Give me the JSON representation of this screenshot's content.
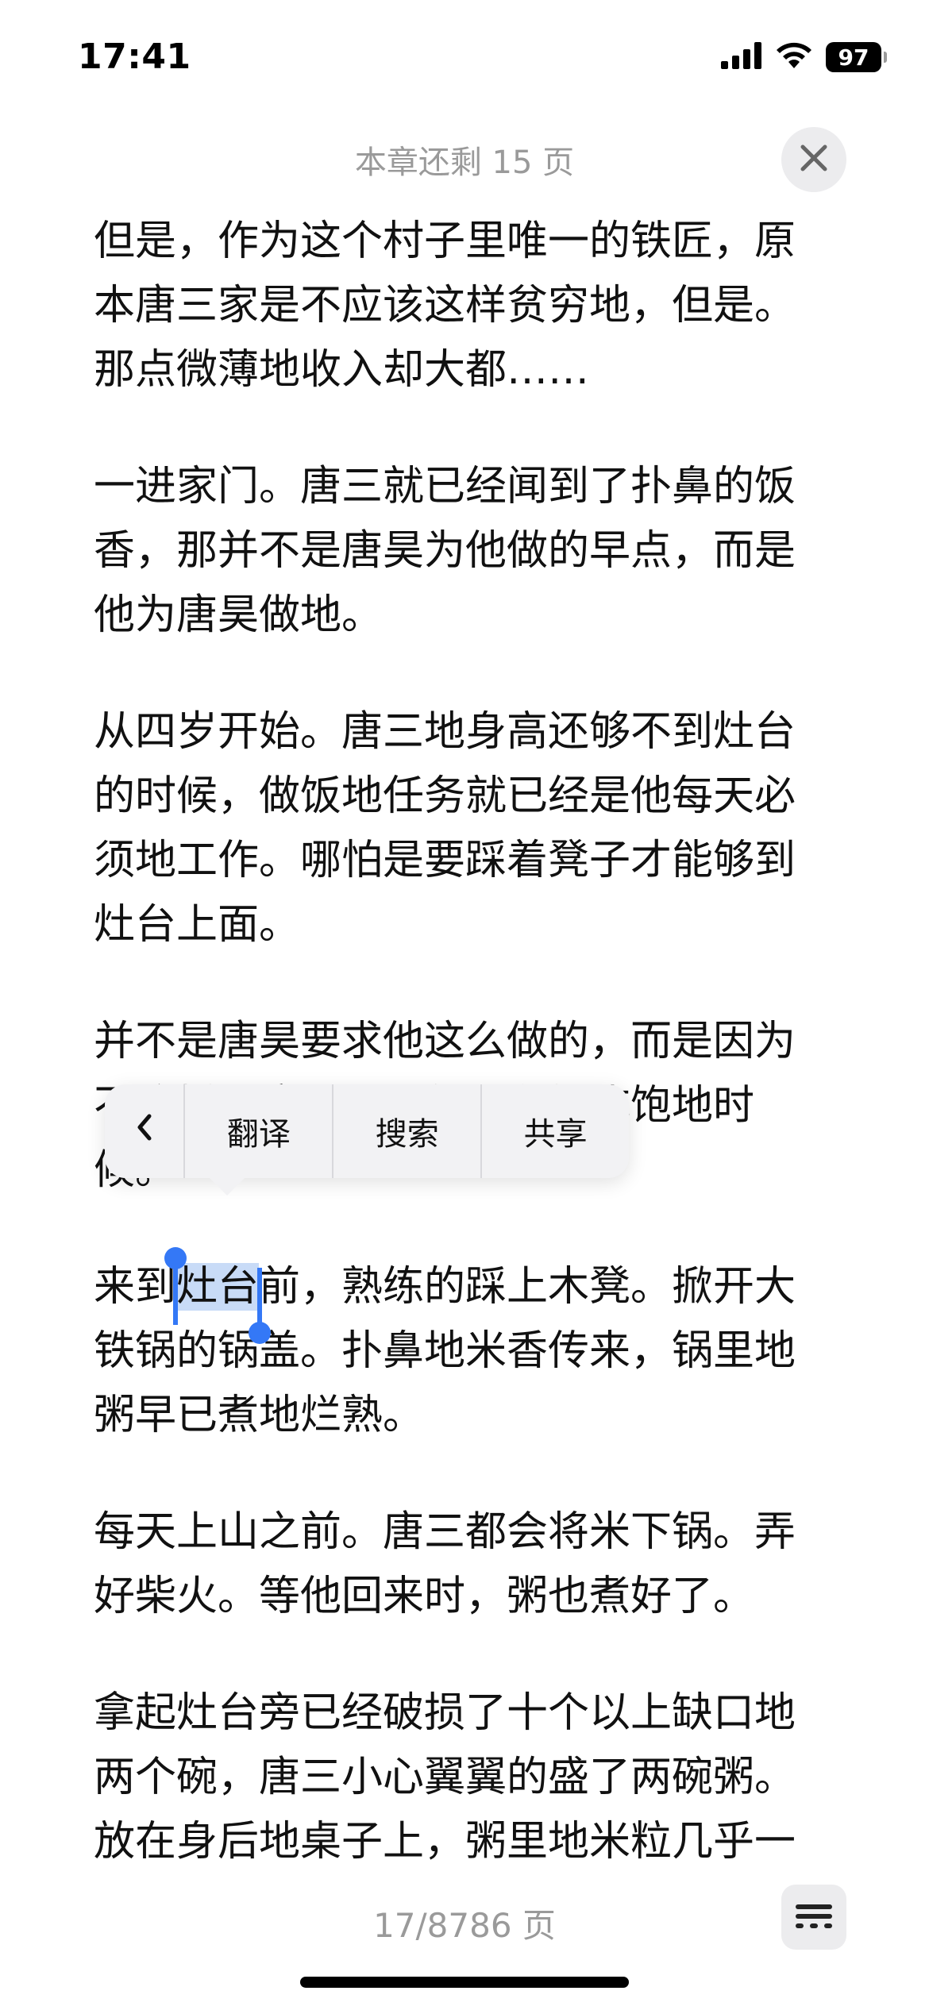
{
  "status_bar": {
    "time": "17:41",
    "battery": "97"
  },
  "header": {
    "chapter_remaining": "本章还剩 15 页"
  },
  "paragraphs": [
    "但是，作为这个村子里唯一的铁匠，原本唐三家是不应该这样贫穷地，但是。那点微薄地收入却大都……",
    "一进家门。唐三就已经闻到了扑鼻的饭香，那并不是唐昊为他做的早点，而是他为唐昊做地。",
    "从四岁开始。唐三地身高还够不到灶台的时候，做饭地任务就已经是他每天必须地工作。哪怕是要踩着凳子才能够到灶台上面。",
    "并不是唐昊要求他这么做的，而是因为不这样，唐三几乎就没有能吃饱地时候。"
  ],
  "selection_paragraph": {
    "before": "来到",
    "selected": "灶台",
    "after": "前，熟练的踩上木凳。掀开大铁锅的锅盖。扑鼻地米香传来，锅里地粥早已煮地烂熟。"
  },
  "paragraphs_after": [
    "每天上山之前。唐三都会将米下锅。弄好柴火。等他回来时，粥也煮好了。",
    "拿起灶台旁已经破损了十个以上缺口地两个碗，唐三小心翼翼的盛了两碗粥。放在身后地桌子上，粥里地米粒几乎一"
  ],
  "context_menu": {
    "items": [
      "翻译",
      "搜索",
      "共享"
    ]
  },
  "footer": {
    "page_indicator": "17/8786 页"
  }
}
